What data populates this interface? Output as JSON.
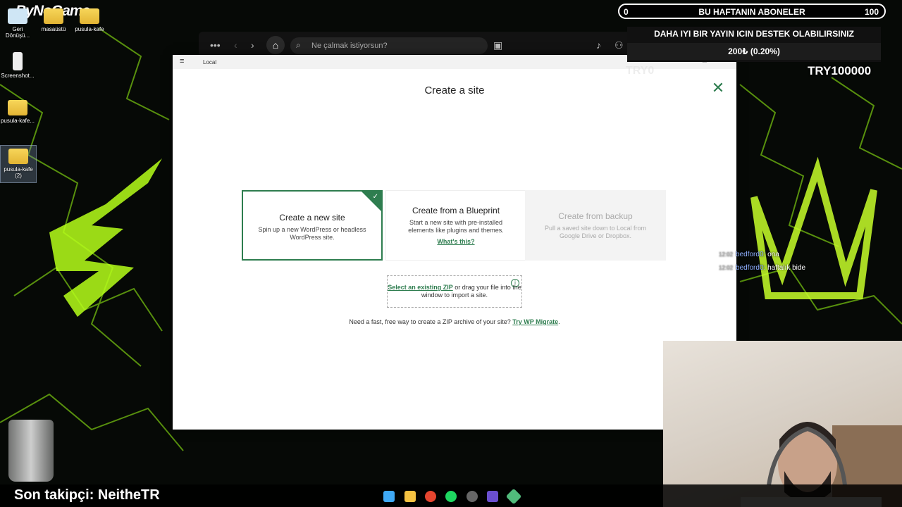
{
  "desktop": {
    "logo": "ByNoGame",
    "icons": [
      {
        "label": "Geri Dönüşü..."
      },
      {
        "label": "masaüstü"
      },
      {
        "label": "pusula-kafe"
      },
      {
        "label": "Screenshot..."
      },
      {
        "label": "pusula-kafe..."
      },
      {
        "label": "pusula-kafe (2)"
      }
    ]
  },
  "spotify": {
    "search_placeholder": "Ne çalmak istiyorsun?"
  },
  "local": {
    "window_title": "Local",
    "modal_title": "Create a site",
    "cards": {
      "new": {
        "title": "Create a new site",
        "desc": "Spin up a new WordPress or headless WordPress site."
      },
      "blueprint": {
        "title": "Create from a Blueprint",
        "desc": "Start a new site with pre-installed elements like plugins and themes.",
        "link": "What's this?"
      },
      "backup": {
        "title": "Create from backup",
        "desc": "Pull a saved site down to Local from Google Drive or Dropbox."
      }
    },
    "zip": {
      "link": "Select an existing ZIP",
      "text": " or drag your file into the window to import a site."
    },
    "footer": {
      "text": "Need a fast, free way to create a ZIP archive of your site? ",
      "link": "Try WP Migrate",
      "end": "."
    }
  },
  "overlay": {
    "sub_left": "0",
    "sub_title": "BU HAFTANIN ABONELER",
    "sub_right": "100",
    "support_text": "DAHA IYI BIR YAYIN ICIN DESTEK OLABILIRSINIZ",
    "support_progress": "200₺ (0.20%)",
    "try_left": "TRY0",
    "try_right": "TRY100000",
    "chat": [
      {
        "time": "12:02",
        "user": "bedford0:",
        "msg": "ona"
      },
      {
        "time": "12:02",
        "user": "bedford0:",
        "msg": "haftalık bide"
      }
    ],
    "follower": "Son takipçi: NeitheTR"
  },
  "colors": {
    "accent": "#2e7d4f",
    "neon": "#b6ff1a"
  }
}
